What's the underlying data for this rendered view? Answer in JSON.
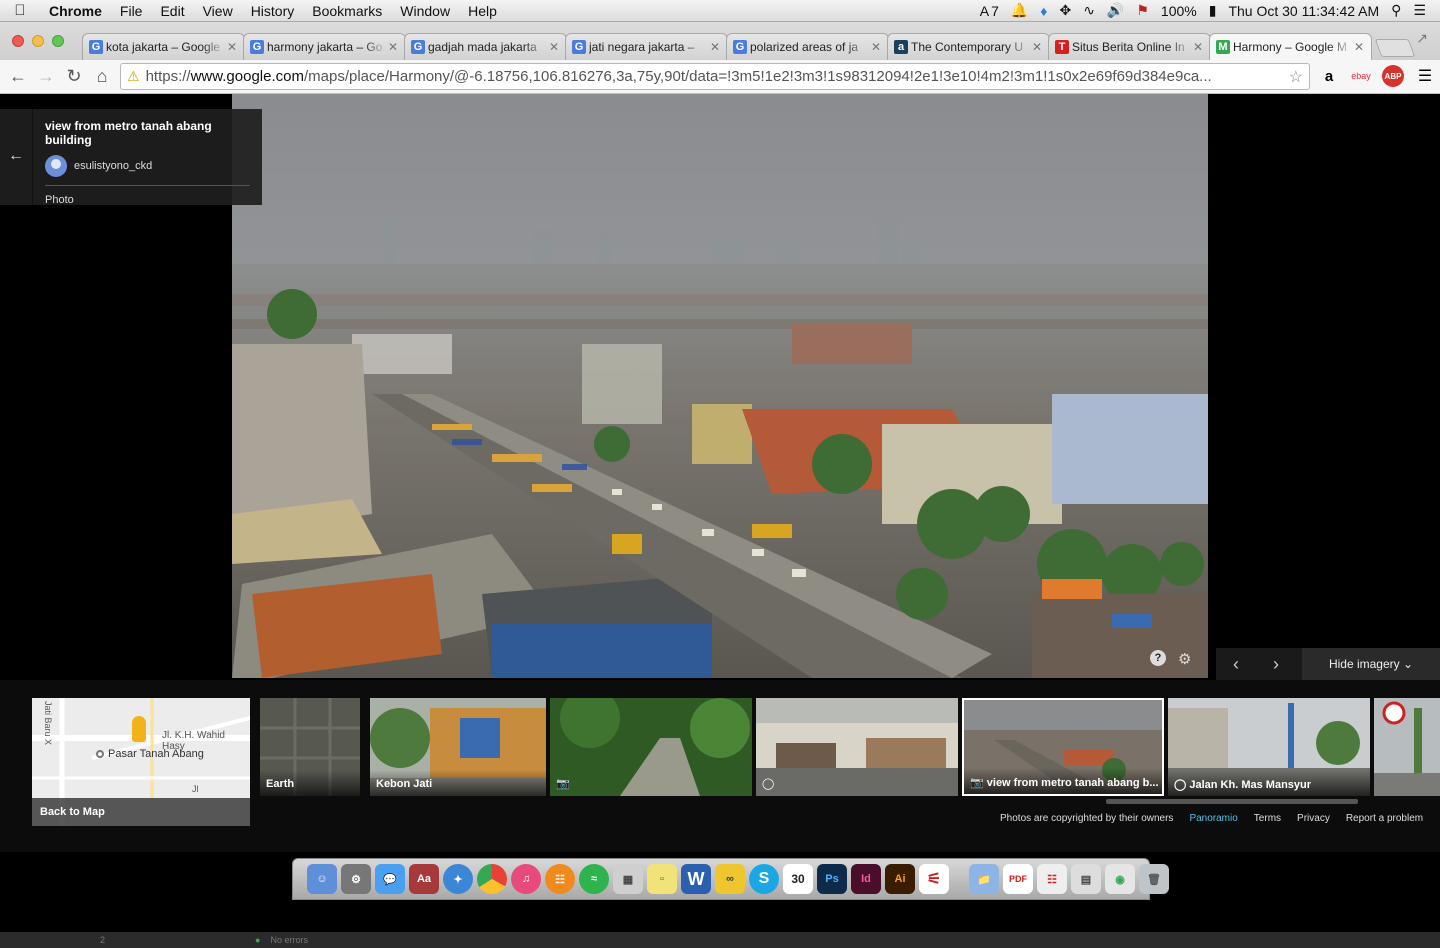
{
  "menubar": {
    "app": "Chrome",
    "items": [
      "File",
      "Edit",
      "View",
      "History",
      "Bookmarks",
      "Window",
      "Help"
    ],
    "status": {
      "adobe_count": "7",
      "battery": "100%",
      "clock": "Thu Oct 30  11:34:42 AM"
    }
  },
  "tabs": [
    {
      "title": "kota jakarta – Google",
      "favicon": "G",
      "color": "#4a7ce0"
    },
    {
      "title": "harmony jakarta – Go",
      "favicon": "G",
      "color": "#4a7ce0"
    },
    {
      "title": "gadjah mada jakarta",
      "favicon": "G",
      "color": "#4a7ce0"
    },
    {
      "title": "jati negara jakarta –",
      "favicon": "G",
      "color": "#4a7ce0"
    },
    {
      "title": "polarized areas of ja",
      "favicon": "G",
      "color": "#4a7ce0"
    },
    {
      "title": "The Contemporary U",
      "favicon": "a",
      "color": "#1c3f5e"
    },
    {
      "title": "Situs Berita Online In",
      "favicon": "T",
      "color": "#d61f1f"
    },
    {
      "title": "Harmony – Google M",
      "favicon": "M",
      "color": "#34a853",
      "active": true
    }
  ],
  "omnibox": {
    "scheme": "https://",
    "host": "www.google.com",
    "path": "/maps/place/Harmony/@-6.18756,106.816276,3a,75y,90t/data=!3m5!1e2!3m3!1s98312094!2e1!3e10!4m2!3m1!1s0x2e69f69d384e9ca..."
  },
  "extensions": [
    "a",
    "ebay",
    "ABP"
  ],
  "photo": {
    "title": "view from metro tanah abang building",
    "author": "esulistyono_ckd",
    "type": "Photo"
  },
  "nav": {
    "hide_label": "Hide imagery"
  },
  "strip": {
    "back_to_map": "Back to Map",
    "map_labels": [
      "Jl. K.H. Wahid Hasy",
      "Pasar Tanah Abang",
      "Jati Baru X",
      "Jl"
    ],
    "thumbs": [
      {
        "label": "Earth"
      },
      {
        "label": "Kebon Jati"
      },
      {
        "label": ""
      },
      {
        "label": ""
      },
      {
        "label": "view from metro tanah abang b..."
      },
      {
        "label": "Jalan Kh. Mas Mansyur"
      },
      {
        "label": ""
      }
    ]
  },
  "footer": {
    "copyright": "Photos are copyrighted by their owners",
    "panoramio": "Panoramio",
    "terms": "Terms",
    "privacy": "Privacy",
    "report": "Report a problem"
  },
  "statusbar": {
    "page": "2",
    "errors": "No errors"
  }
}
